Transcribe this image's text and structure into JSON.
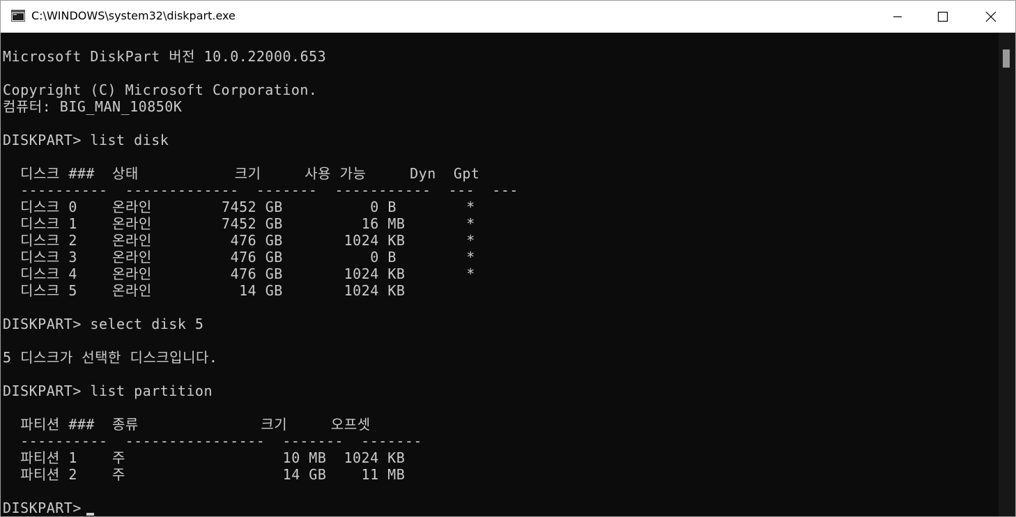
{
  "window": {
    "title": "C:\\WINDOWS\\system32\\diskpart.exe"
  },
  "icons": {
    "app": "console-window-icon",
    "minimize": "minimize-icon",
    "maximize": "maximize-icon",
    "close": "close-icon"
  },
  "console": {
    "lines": [
      "Microsoft DiskPart 버전 10.0.22000.653",
      "",
      "Copyright (C) Microsoft Corporation.",
      "컴퓨터: BIG_MAN_10850K",
      "",
      "DISKPART> list disk",
      "",
      "  디스크 ###  상태           크기     사용 가능     Dyn  Gpt",
      "  ----------  -------------  -------  -----------  ---  ---",
      "  디스크 0    온라인        7452 GB          0 B        *",
      "  디스크 1    온라인        7452 GB         16 MB       *",
      "  디스크 2    온라인         476 GB       1024 KB       *",
      "  디스크 3    온라인         476 GB          0 B        *",
      "  디스크 4    온라인         476 GB       1024 KB       *",
      "  디스크 5    온라인          14 GB       1024 KB",
      "",
      "DISKPART> select disk 5",
      "",
      "5 디스크가 선택한 디스크입니다.",
      "",
      "DISKPART> list partition",
      "",
      "  파티션 ###  종류              크기     오프셋",
      "  ----------  ----------------  -------  -------",
      "  파티션 1    주                  10 MB  1024 KB",
      "  파티션 2    주                  14 GB    11 MB",
      "",
      "DISKPART> "
    ]
  }
}
